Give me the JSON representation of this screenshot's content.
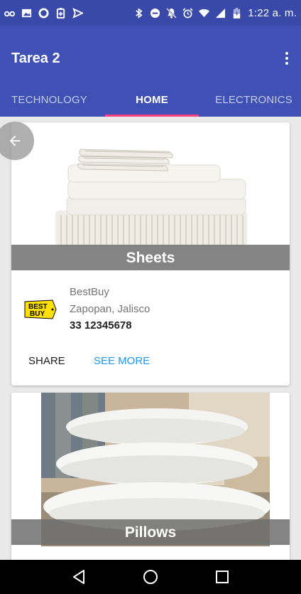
{
  "status_bar": {
    "time": "1:22 a. m.",
    "left_icons": [
      "voicemail-icon",
      "image-icon",
      "circle-icon",
      "battery-saver-icon",
      "send-icon"
    ],
    "right_icons": [
      "bluetooth-icon",
      "do-not-disturb-icon",
      "notifications-off-icon",
      "alarm-icon",
      "wifi-icon",
      "signal-icon",
      "battery-icon"
    ]
  },
  "app_bar": {
    "title": "Tarea 2",
    "menu_icon": "more-vert-icon",
    "color": "#3f51b5",
    "status_color": "#3849a9"
  },
  "tabs": [
    {
      "label": "TECHNOLOGY",
      "active": false
    },
    {
      "label": "HOME",
      "active": true
    },
    {
      "label": "ELECTRONICS",
      "active": false
    }
  ],
  "cards": [
    {
      "title": "Sheets",
      "store": "BestBuy",
      "location": "Zapopan, Jalisco",
      "phone": "33 12345678",
      "logo": "best-buy-logo",
      "actions": {
        "share": "SHARE",
        "more": "SEE MORE"
      }
    },
    {
      "title": "Pillows"
    }
  ],
  "nav_bar": {
    "icons": [
      "back-icon",
      "home-icon",
      "recents-icon"
    ]
  },
  "colors": {
    "accent": "#ff4081",
    "link": "#2196f3"
  }
}
